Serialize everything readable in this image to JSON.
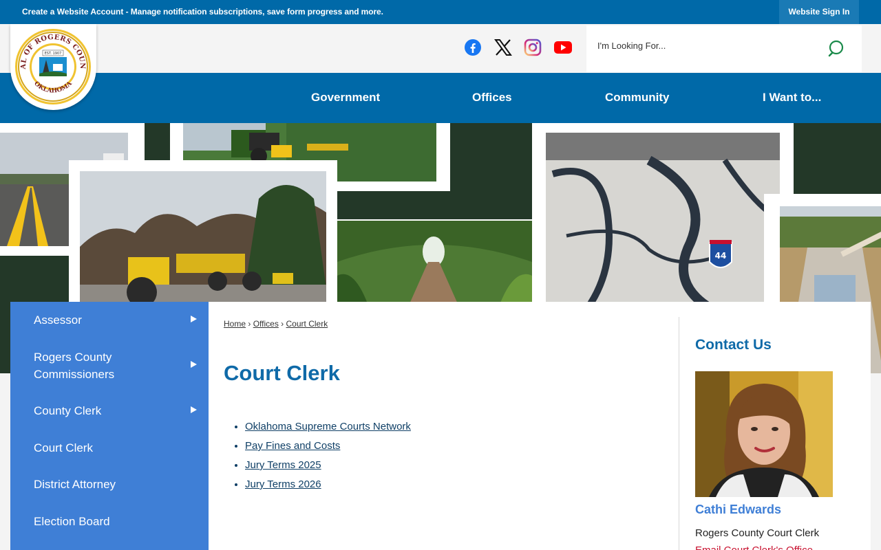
{
  "topbar": {
    "notice_bold": "Create a Website Account",
    "notice_rest": " - Manage notification subscriptions, save form progress and more.",
    "signin_label": "Website Sign In"
  },
  "logo": {
    "top_text": "SEAL OF ROGERS COUNTY",
    "est_text": "EST. 1907",
    "bottom_text": "OKLAHOMA"
  },
  "social": [
    {
      "name": "facebook-icon",
      "color": "#1877f2"
    },
    {
      "name": "x-icon",
      "color": "#000000"
    },
    {
      "name": "instagram-icon",
      "color": "#d62976"
    },
    {
      "name": "youtube-icon",
      "color": "#ff0000"
    }
  ],
  "search": {
    "placeholder": "I'm Looking For..."
  },
  "nav": {
    "items": [
      "Government",
      "Offices",
      "Community",
      "I Want to..."
    ]
  },
  "banner": {
    "sign_text": "44"
  },
  "sidebar": {
    "items": [
      {
        "label": "Assessor",
        "has_submenu": true
      },
      {
        "label": "Rogers County Commissioners",
        "has_submenu": true
      },
      {
        "label": "County Clerk",
        "has_submenu": true
      },
      {
        "label": "Court Clerk",
        "has_submenu": false
      },
      {
        "label": "District Attorney",
        "has_submenu": false
      },
      {
        "label": "Election Board",
        "has_submenu": false
      }
    ]
  },
  "breadcrumb": {
    "home": "Home",
    "sep": "›",
    "offices": "Offices",
    "current": "Court Clerk"
  },
  "page": {
    "title": "Court Clerk",
    "links": [
      "Oklahoma Supreme Courts Network",
      "Pay Fines and Costs",
      "Jury Terms 2025",
      "Jury Terms 2026"
    ]
  },
  "contact": {
    "title": "Contact Us",
    "name": "Cathi Edwards",
    "role": "Rogers County Court Clerk",
    "email_label": "Email Court Clerk's Office"
  },
  "colors": {
    "primary_blue": "#0069a8",
    "sidebar_blue": "#3f7fd6",
    "banner_green": "#233828",
    "email_red": "#c8102e"
  }
}
